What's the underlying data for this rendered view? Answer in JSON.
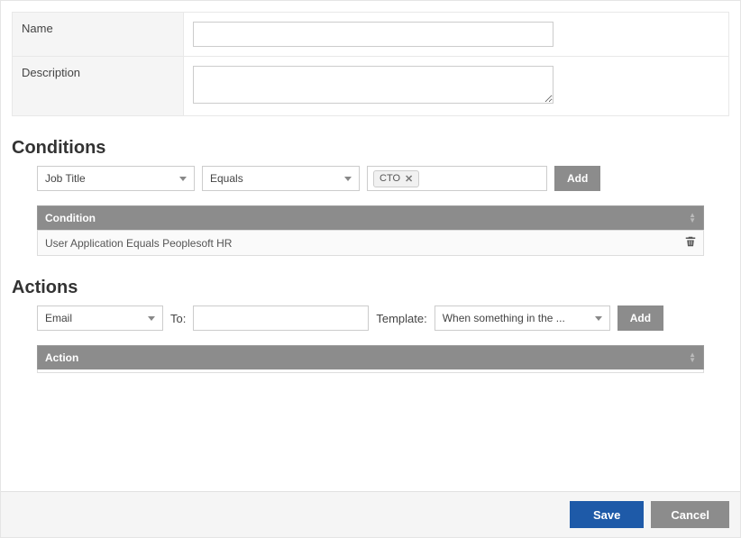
{
  "form": {
    "nameLabel": "Name",
    "nameValue": "",
    "descriptionLabel": "Description",
    "descriptionValue": ""
  },
  "conditions": {
    "heading": "Conditions",
    "fieldSelect": "Job Title",
    "operatorSelect": "Equals",
    "chipLabel": "CTO",
    "addButton": "Add",
    "tableHeader": "Condition",
    "rows": [
      "User Application Equals Peoplesoft HR"
    ]
  },
  "actions": {
    "heading": "Actions",
    "typeSelect": "Email",
    "toLabel": "To:",
    "toValue": "",
    "templateLabel": "Template:",
    "templateSelect": "When something in the ...",
    "addButton": "Add",
    "tableHeader": "Action"
  },
  "footer": {
    "save": "Save",
    "cancel": "Cancel"
  }
}
